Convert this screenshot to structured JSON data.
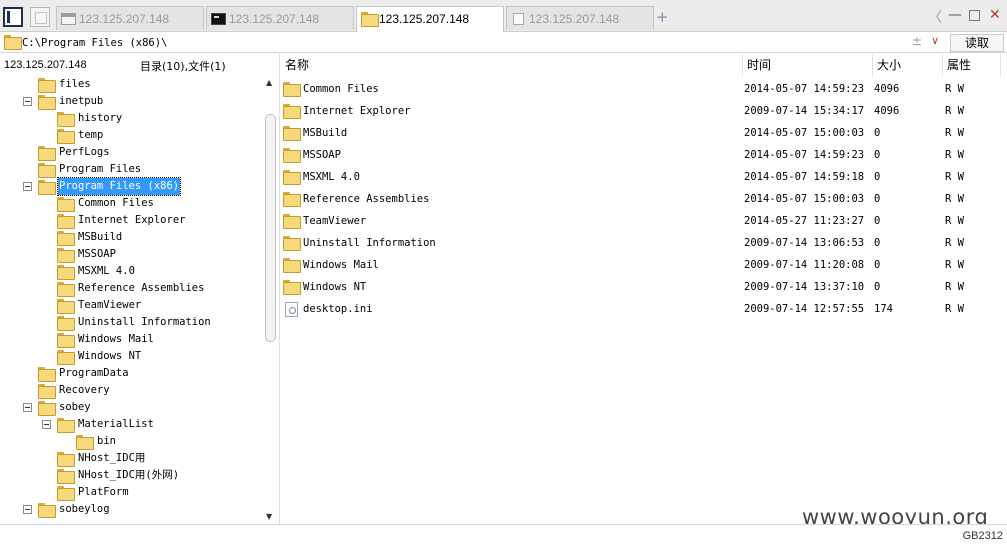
{
  "tabs": [
    {
      "label": "123.125.207.148",
      "icon": "window-icon",
      "active": false
    },
    {
      "label": "123.125.207.148",
      "icon": "terminal-icon",
      "active": false
    },
    {
      "label": "123.125.207.148",
      "icon": "folder-icon",
      "active": true
    },
    {
      "label": "123.125.207.148",
      "icon": "document-icon",
      "active": false
    }
  ],
  "tab_add_symbol": "+",
  "window_controls": {
    "back": "〈",
    "minimize": "—",
    "maximize": "□",
    "close": "✕"
  },
  "address": {
    "path": "C:\\Program Files (x86)\\",
    "separator": "±",
    "dropdown": "∨",
    "read_button": "读取"
  },
  "left": {
    "host": "123.125.207.148",
    "counts": "目录(10),文件(1)"
  },
  "tree": [
    {
      "label": "files",
      "level": 1,
      "toggle": false,
      "selected": false
    },
    {
      "label": "inetpub",
      "level": 1,
      "toggle": true,
      "selected": false
    },
    {
      "label": "history",
      "level": 2,
      "toggle": false,
      "selected": false
    },
    {
      "label": "temp",
      "level": 2,
      "toggle": false,
      "selected": false
    },
    {
      "label": "PerfLogs",
      "level": 1,
      "toggle": false,
      "selected": false
    },
    {
      "label": "Program Files",
      "level": 1,
      "toggle": false,
      "selected": false
    },
    {
      "label": "Program Files (x86)",
      "level": 1,
      "toggle": true,
      "selected": true
    },
    {
      "label": "Common Files",
      "level": 2,
      "toggle": false,
      "selected": false
    },
    {
      "label": "Internet Explorer",
      "level": 2,
      "toggle": false,
      "selected": false
    },
    {
      "label": "MSBuild",
      "level": 2,
      "toggle": false,
      "selected": false
    },
    {
      "label": "MSSOAP",
      "level": 2,
      "toggle": false,
      "selected": false
    },
    {
      "label": "MSXML 4.0",
      "level": 2,
      "toggle": false,
      "selected": false
    },
    {
      "label": "Reference Assemblies",
      "level": 2,
      "toggle": false,
      "selected": false
    },
    {
      "label": "TeamViewer",
      "level": 2,
      "toggle": false,
      "selected": false
    },
    {
      "label": "Uninstall Information",
      "level": 2,
      "toggle": false,
      "selected": false
    },
    {
      "label": "Windows Mail",
      "level": 2,
      "toggle": false,
      "selected": false
    },
    {
      "label": "Windows NT",
      "level": 2,
      "toggle": false,
      "selected": false
    },
    {
      "label": "ProgramData",
      "level": 1,
      "toggle": false,
      "selected": false
    },
    {
      "label": "Recovery",
      "level": 1,
      "toggle": false,
      "selected": false
    },
    {
      "label": "sobey",
      "level": 1,
      "toggle": true,
      "selected": false
    },
    {
      "label": "MaterialList",
      "level": 2,
      "toggle": true,
      "selected": false
    },
    {
      "label": "bin",
      "level": 3,
      "toggle": false,
      "selected": false
    },
    {
      "label": "NHost_IDC用",
      "level": 2,
      "toggle": false,
      "selected": false
    },
    {
      "label": "NHost_IDC用(外网)",
      "level": 2,
      "toggle": false,
      "selected": false
    },
    {
      "label": "PlatForm",
      "level": 2,
      "toggle": false,
      "selected": false
    },
    {
      "label": "sobeylog",
      "level": 1,
      "toggle": true,
      "selected": false
    },
    {
      "label": "·",
      "level": 2,
      "toggle": false,
      "selected": false
    }
  ],
  "tree_scroll": {
    "up": "▲",
    "down": "▼"
  },
  "columns": {
    "name": "名称",
    "time": "时间",
    "size": "大小",
    "attr": "属性"
  },
  "files": [
    {
      "name": "Common Files",
      "time": "2014-05-07 14:59:23",
      "size": "4096",
      "attr": "R W",
      "type": "folder"
    },
    {
      "name": "Internet Explorer",
      "time": "2009-07-14 15:34:17",
      "size": "4096",
      "attr": "R W",
      "type": "folder"
    },
    {
      "name": "MSBuild",
      "time": "2014-05-07 15:00:03",
      "size": "0",
      "attr": "R W",
      "type": "folder"
    },
    {
      "name": "MSSOAP",
      "time": "2014-05-07 14:59:23",
      "size": "0",
      "attr": "R W",
      "type": "folder"
    },
    {
      "name": "MSXML 4.0",
      "time": "2014-05-07 14:59:18",
      "size": "0",
      "attr": "R W",
      "type": "folder"
    },
    {
      "name": "Reference Assemblies",
      "time": "2014-05-07 15:00:03",
      "size": "0",
      "attr": "R W",
      "type": "folder"
    },
    {
      "name": "TeamViewer",
      "time": "2014-05-27 11:23:27",
      "size": "0",
      "attr": "R W",
      "type": "folder"
    },
    {
      "name": "Uninstall Information",
      "time": "2009-07-14 13:06:53",
      "size": "0",
      "attr": "R W",
      "type": "folder"
    },
    {
      "name": "Windows Mail",
      "time": "2009-07-14 11:20:08",
      "size": "0",
      "attr": "R W",
      "type": "folder"
    },
    {
      "name": "Windows NT",
      "time": "2009-07-14 13:37:10",
      "size": "0",
      "attr": "R W",
      "type": "folder"
    },
    {
      "name": "desktop.ini",
      "time": "2009-07-14 12:57:55",
      "size": "174",
      "attr": "R W",
      "type": "file"
    }
  ],
  "watermark": "www.wooyun.org",
  "encoding": "GB2312",
  "colors": {
    "selection": "#3399ff",
    "folder": "#f6d97a",
    "close": "#c0392b"
  }
}
